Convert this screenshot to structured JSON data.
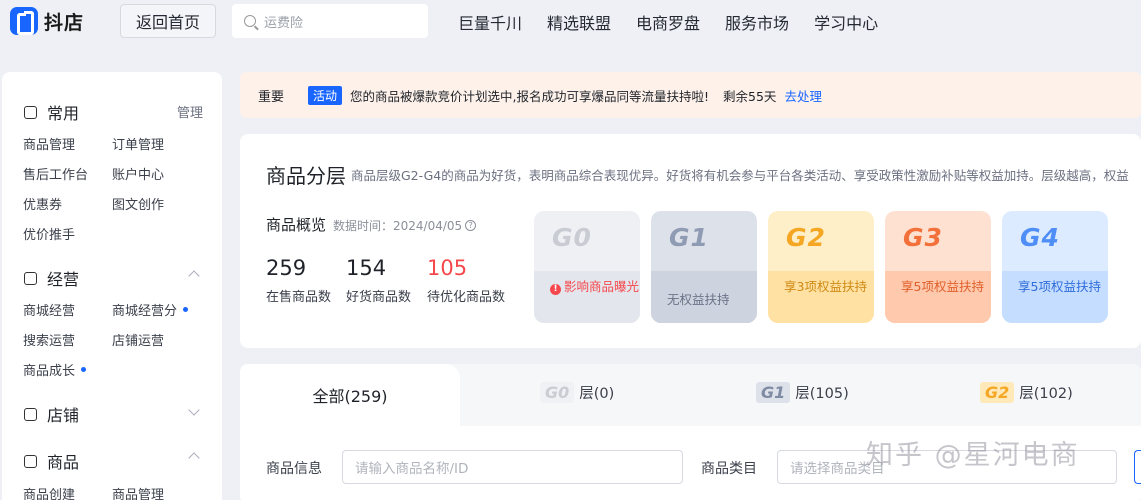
{
  "header": {
    "logo_text": "抖店",
    "back_label": "返回首页",
    "search_placeholder": "运费险",
    "nav": [
      "巨量千川",
      "精选联盟",
      "电商罗盘",
      "服务市场",
      "学习中心"
    ]
  },
  "sidebar": {
    "common": {
      "title": "常用",
      "manage": "管理",
      "items": [
        "商品管理",
        "订单管理",
        "售后工作台",
        "账户中心",
        "优惠券",
        "图文创作",
        "优价推手"
      ]
    },
    "operation": {
      "title": "经营",
      "items": [
        "商城经营",
        "商城经营分",
        "搜索运营",
        "店铺运营",
        "商品成长"
      ]
    },
    "store": {
      "title": "店铺"
    },
    "product": {
      "title": "商品",
      "items": [
        "商品创建",
        "商品管理"
      ]
    }
  },
  "notice": {
    "important": "重要",
    "tag": "活动",
    "message": "您的商品被爆款竞价计划选中,报名成功可享爆品同等流量扶持啦!",
    "remaining": "剩余55天",
    "action": "去处理"
  },
  "tier": {
    "title": "商品分层",
    "desc": "商品层级G2-G4的商品为好货，表明商品综合表现优异。好货将有机会参与平台各类活动、享受政策性激励补贴等权益加持。层级越高，权益",
    "overview_title": "商品概览",
    "data_time": "数据时间：2024/04/05",
    "stats": [
      {
        "value": "259",
        "label": "在售商品数"
      },
      {
        "value": "154",
        "label": "好货商品数"
      },
      {
        "value": "105",
        "label": "待优化商品数"
      }
    ],
    "levels": [
      {
        "badge": "G0",
        "text": "影响商品曝光"
      },
      {
        "badge": "G1",
        "text": "无权益扶持"
      },
      {
        "badge": "G2",
        "text": "享3项权益扶持"
      },
      {
        "badge": "G3",
        "text": "享5项权益扶持"
      },
      {
        "badge": "G4",
        "text": "享5项权益扶持"
      }
    ]
  },
  "tabs": {
    "all": "全部(259)",
    "g0": {
      "badge": "G0",
      "label": "层(0)"
    },
    "g1": {
      "badge": "G1",
      "label": "层(105)"
    },
    "g2": {
      "badge": "G2",
      "label": "层(102)"
    }
  },
  "filters": {
    "info_label": "商品信息",
    "info_placeholder": "请输入商品名称/ID",
    "category_label": "商品类目",
    "category_placeholder": "请选择商品类目"
  },
  "watermark": "知乎 @星河电商",
  "colors": {
    "accent": "#1966ff",
    "danger": "#f5484d",
    "notice_bg": "#fdf1ea"
  }
}
